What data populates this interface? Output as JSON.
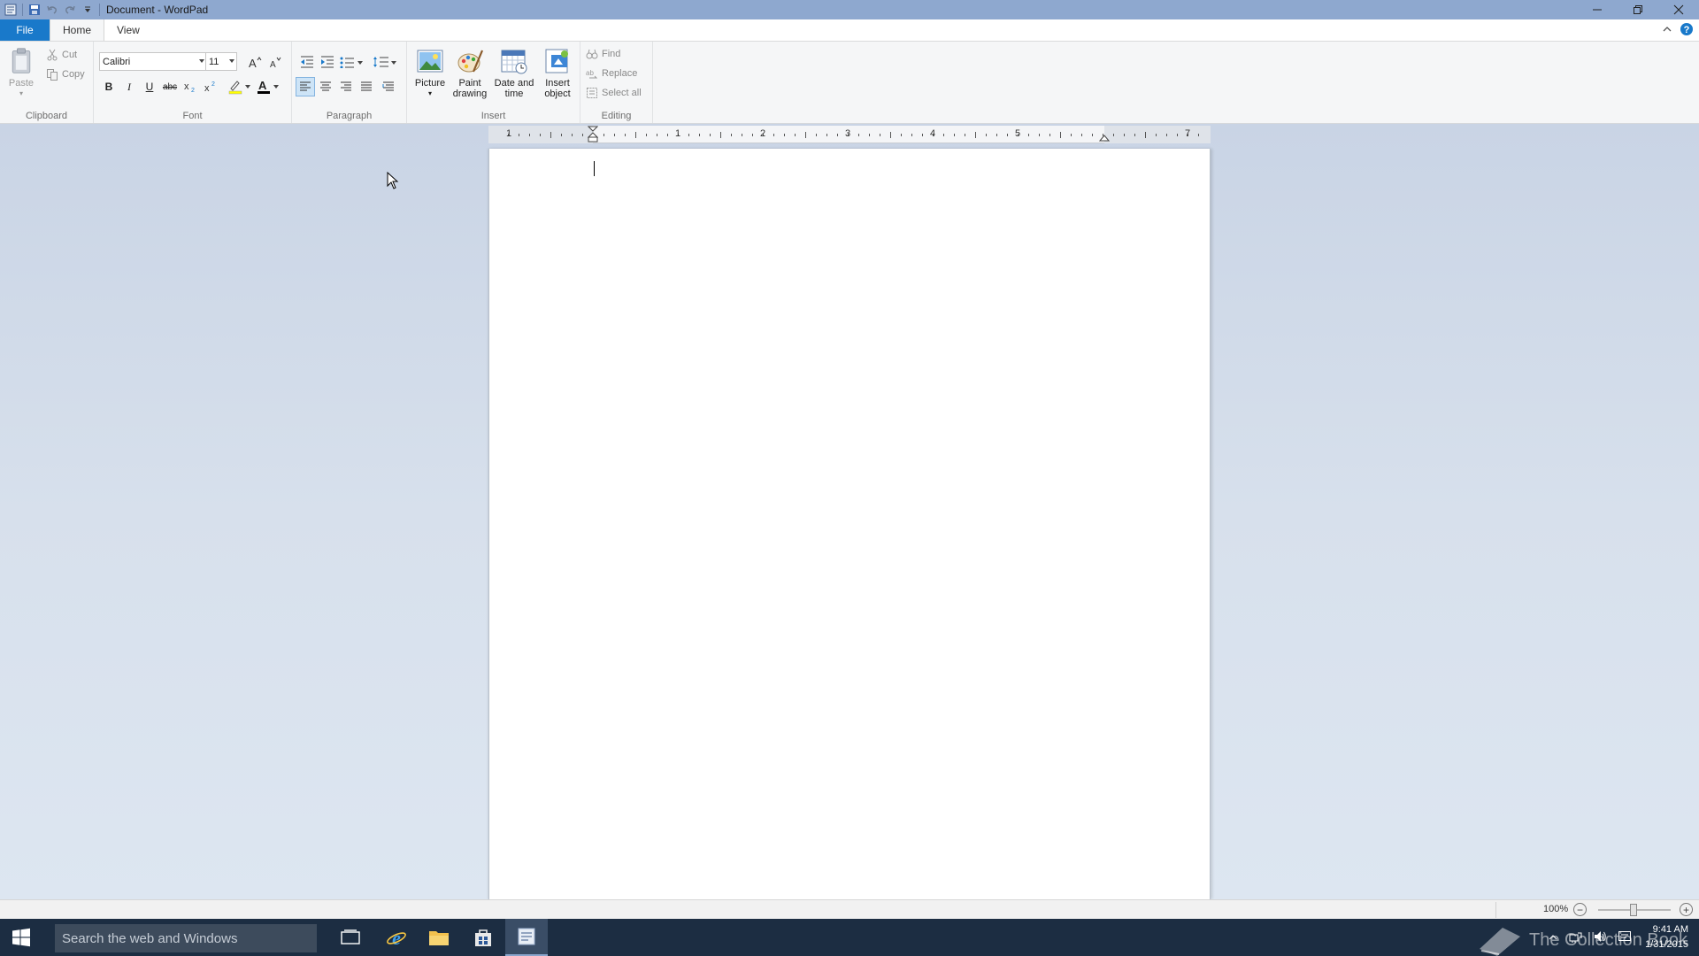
{
  "window": {
    "title": "Document - WordPad"
  },
  "tabs": {
    "file": "File",
    "home": "Home",
    "view": "View"
  },
  "clipboard": {
    "paste": "Paste",
    "cut": "Cut",
    "copy": "Copy",
    "label": "Clipboard"
  },
  "font": {
    "family": "Calibri",
    "size": "11",
    "label": "Font",
    "bold": "B",
    "italic": "I",
    "underline": "U",
    "strike": "abc"
  },
  "paragraph": {
    "label": "Paragraph"
  },
  "insert": {
    "picture": "Picture",
    "paint_line1": "Paint",
    "paint_line2": "drawing",
    "date_line1": "Date and",
    "date_line2": "time",
    "object_line1": "Insert",
    "object_line2": "object",
    "label": "Insert"
  },
  "editing": {
    "find": "Find",
    "replace": "Replace",
    "select_all": "Select all",
    "label": "Editing"
  },
  "ruler": {
    "numbers": [
      "1",
      "1",
      "2",
      "3",
      "4",
      "5",
      "7"
    ]
  },
  "statusbar": {
    "zoom": "100%"
  },
  "taskbar": {
    "search_placeholder": "Search the web and Windows",
    "watermark": "The Collection Book",
    "time": "9:41 AM",
    "date": "1/31/2015"
  },
  "colors": {
    "titlebar": "#8ea8cf",
    "file_tab": "#1979ca",
    "taskbar": "#1c2d42"
  }
}
